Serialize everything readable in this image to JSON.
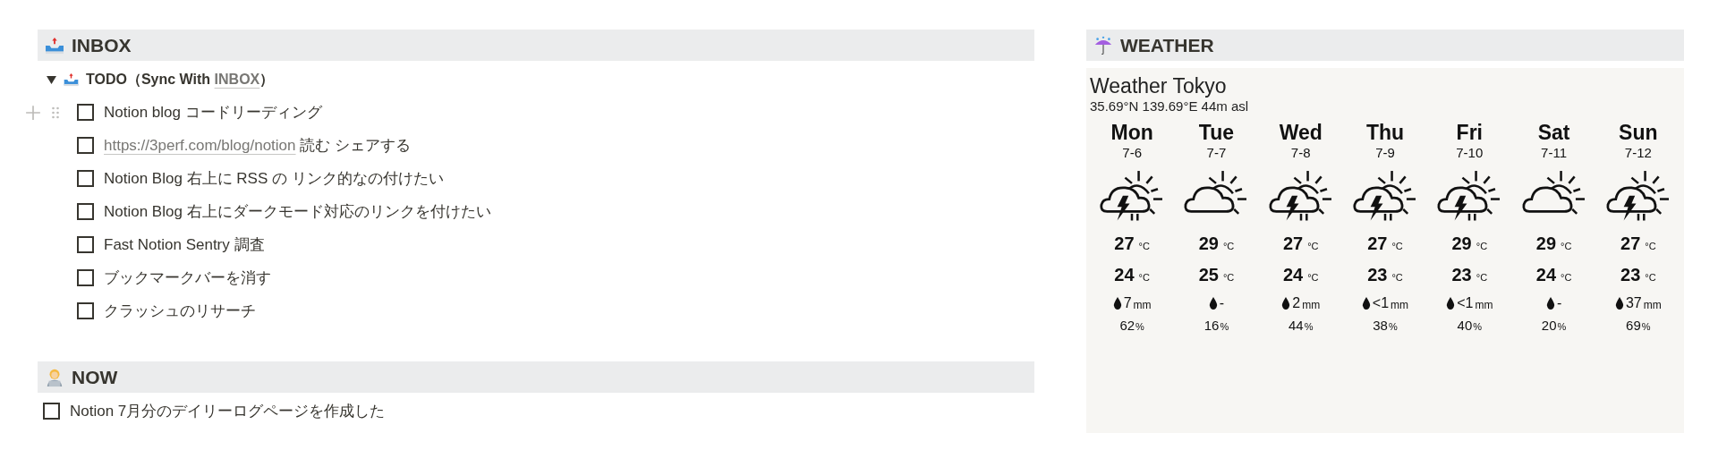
{
  "inbox": {
    "title": "INBOX",
    "toggle": {
      "expanded": true,
      "prefix": "TODO（Sync With ",
      "link": "INBOX",
      "suffix": "）"
    },
    "items": [
      {
        "text": "Notion blog コードリーディング",
        "checked": false,
        "hovered": true
      },
      {
        "link": "https://3perf.com/blog/notion",
        "text": " 読む シェアする",
        "checked": false,
        "hovered": false
      },
      {
        "text": "Notion Blog 右上に RSS の リンク的なの付けたい",
        "checked": false,
        "hovered": false
      },
      {
        "text": "Notion Blog 右上にダークモード対応のリンクを付けたい",
        "checked": false,
        "hovered": false
      },
      {
        "text": "Fast Notion Sentry 調査",
        "checked": false,
        "hovered": false
      },
      {
        "text": "ブックマークバーを消す",
        "checked": false,
        "hovered": false
      },
      {
        "text": "クラッシュのリサーチ",
        "checked": false,
        "hovered": false
      }
    ]
  },
  "now": {
    "title": "NOW",
    "items": [
      {
        "text": "Notion 7月分のデイリーログページを作成した",
        "checked": false
      }
    ]
  },
  "weather": {
    "title": "WEATHER",
    "place": "Weather Tokyo",
    "coords": "35.69°N 139.69°E 44m asl",
    "days": [
      {
        "day": "Mon",
        "date": "7-6",
        "kind": "storm",
        "high": "27",
        "high_unit": "°C",
        "low": "24",
        "low_unit": "°C",
        "precip": "7",
        "precip_unit": "mm",
        "chance": "62",
        "chance_unit": "%"
      },
      {
        "day": "Tue",
        "date": "7-7",
        "kind": "cloud",
        "high": "29",
        "high_unit": "°C",
        "low": "25",
        "low_unit": "°C",
        "precip": "-",
        "chance": "16",
        "chance_unit": "%"
      },
      {
        "day": "Wed",
        "date": "7-8",
        "kind": "storm",
        "high": "27",
        "high_unit": "°C",
        "low": "24",
        "low_unit": "°C",
        "precip": "2",
        "precip_unit": "mm",
        "chance": "44",
        "chance_unit": "%"
      },
      {
        "day": "Thu",
        "date": "7-9",
        "kind": "storm",
        "high": "27",
        "high_unit": "°C",
        "low": "23",
        "low_unit": "°C",
        "precip": "<1",
        "precip_unit": "mm",
        "chance": "38",
        "chance_unit": "%"
      },
      {
        "day": "Fri",
        "date": "7-10",
        "kind": "storm",
        "high": "29",
        "high_unit": "°C",
        "low": "23",
        "low_unit": "°C",
        "precip": "<1",
        "precip_unit": "mm",
        "chance": "40",
        "chance_unit": "%"
      },
      {
        "day": "Sat",
        "date": "7-11",
        "kind": "cloud",
        "high": "29",
        "high_unit": "°C",
        "low": "24",
        "low_unit": "°C",
        "precip": "-",
        "chance": "20",
        "chance_unit": "%"
      },
      {
        "day": "Sun",
        "date": "7-12",
        "kind": "storm",
        "high": "27",
        "high_unit": "°C",
        "low": "23",
        "low_unit": "°C",
        "precip": "37",
        "precip_unit": "mm",
        "chance": "69",
        "chance_unit": "%"
      }
    ]
  }
}
